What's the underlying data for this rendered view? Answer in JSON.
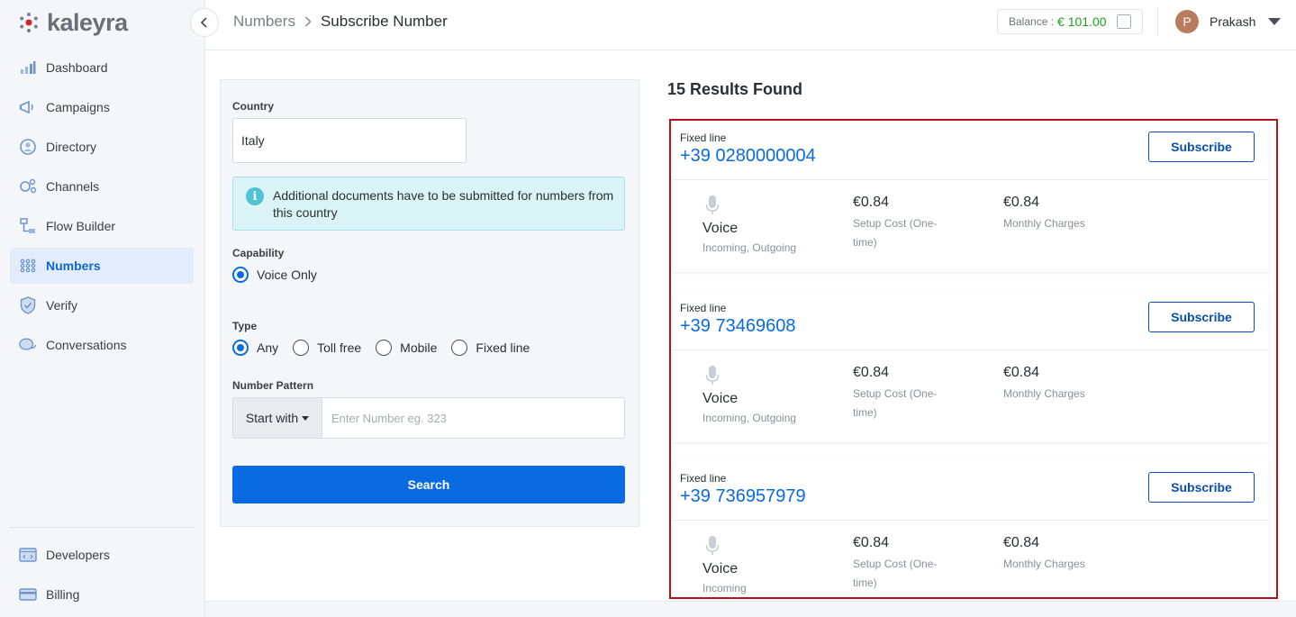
{
  "brand": {
    "name": "kaleyra",
    "accent": "#0a6be0",
    "logo_dot": "#d6222a"
  },
  "sidebar": {
    "items": [
      {
        "label": "Dashboard",
        "icon": "bar-chart-icon"
      },
      {
        "label": "Campaigns",
        "icon": "megaphone-icon"
      },
      {
        "label": "Directory",
        "icon": "person-circle-icon"
      },
      {
        "label": "Channels",
        "icon": "channels-icon"
      },
      {
        "label": "Flow Builder",
        "icon": "flow-icon"
      },
      {
        "label": "Numbers",
        "icon": "dial-pad-icon",
        "active": true
      },
      {
        "label": "Verify",
        "icon": "shield-check-icon"
      },
      {
        "label": "Conversations",
        "icon": "chat-bubbles-icon"
      }
    ],
    "bottom_items": [
      {
        "label": "Developers",
        "icon": "code-window-icon"
      },
      {
        "label": "Billing",
        "icon": "credit-card-icon"
      }
    ]
  },
  "header": {
    "breadcrumb_parent": "Numbers",
    "breadcrumb_current": "Subscribe Number",
    "balance_label": "Balance :",
    "balance_amount": "€ 101.00",
    "user_initial": "P",
    "user_name": "Prakash"
  },
  "search_panel": {
    "country_label": "Country",
    "country_value": "Italy",
    "alert_text": "Additional documents have to be submitted for numbers from this country",
    "capability_label": "Capability",
    "capability_option": "Voice Only",
    "type_label": "Type",
    "type_options": [
      "Any",
      "Toll free",
      "Mobile",
      "Fixed line"
    ],
    "type_selected": "Any",
    "pattern_label": "Number Pattern",
    "pattern_select": "Start with",
    "pattern_placeholder": "Enter Number eg. 323",
    "search_button": "Search"
  },
  "results": {
    "title": "15 Results Found",
    "cards": [
      {
        "type": "Fixed line",
        "number": "+39 0280000004",
        "button": "Subscribe",
        "capability": "Voice",
        "capability_sub": "Incoming, Outgoing",
        "setup_cost": "€0.84",
        "setup_label": "Setup Cost (One-time)",
        "monthly_cost": "€0.84",
        "monthly_label": "Monthly Charges"
      },
      {
        "type": "Fixed line",
        "number": "+39 73469608",
        "button": "Subscribe",
        "capability": "Voice",
        "capability_sub": "Incoming, Outgoing",
        "setup_cost": "€0.84",
        "setup_label": "Setup Cost (One-time)",
        "monthly_cost": "€0.84",
        "monthly_label": "Monthly Charges"
      },
      {
        "type": "Fixed line",
        "number": "+39 736957979",
        "button": "Subscribe",
        "capability": "Voice",
        "capability_sub": "Incoming",
        "setup_cost": "€0.84",
        "setup_label": "Setup Cost (One-time)",
        "monthly_cost": "€0.84",
        "monthly_label": "Monthly Charges"
      }
    ]
  }
}
